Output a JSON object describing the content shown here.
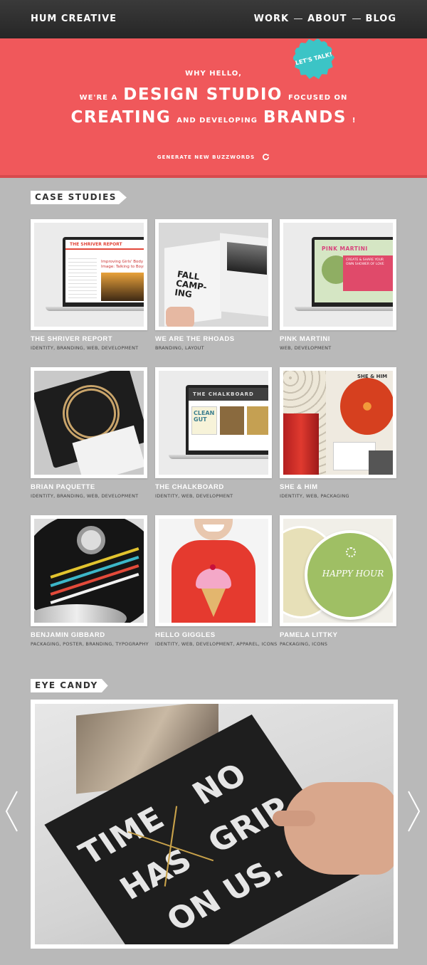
{
  "header": {
    "brand": "HUM CREATIVE",
    "nav": [
      "WORK",
      "ABOUT",
      "BLOG"
    ]
  },
  "hero": {
    "line1": "WHY HELLO,",
    "line2_pre": "WE'RE A",
    "line2_big": "DESIGN STUDIO",
    "line2_post": "FOCUSED ON",
    "line3_big1": "CREATING",
    "line3_mid": "AND DEVELOPING",
    "line3_big2": "BRANDS",
    "line3_end": "!",
    "generate_label": "GENERATE NEW BUZZWORDS",
    "badge": "LET'S TALK!"
  },
  "case_studies": {
    "label": "CASE STUDIES",
    "items": [
      {
        "title": "THE SHRIVER REPORT",
        "tags": "IDENTITY, BRANDING, WEB, DEVELOPMENT"
      },
      {
        "title": "WE ARE THE RHOADS",
        "tags": "BRANDING, LAYOUT"
      },
      {
        "title": "PINK MARTINI",
        "tags": "WEB, DEVELOPMENT"
      },
      {
        "title": "BRIAN PAQUETTE",
        "tags": "IDENTITY, BRANDING, WEB, DEVELOPMENT"
      },
      {
        "title": "THE CHALKBOARD",
        "tags": "IDENTITY, WEB, DEVELOPMENT"
      },
      {
        "title": "SHE & HIM",
        "tags": "IDENTITY, WEB, PACKAGING"
      },
      {
        "title": "BENJAMIN GIBBARD",
        "tags": "PACKAGING, POSTER, BRANDING, TYPOGRAPHY"
      },
      {
        "title": "HELLO GIGGLES",
        "tags": "IDENTITY, WEB, DEVELOPMENT, APPAREL, ICONS"
      },
      {
        "title": "PAMELA LITTKY",
        "tags": "PACKAGING, ICONS"
      }
    ],
    "thumb_text": {
      "shriver_logo": "THE SHRIVER REPORT",
      "shriver_headline": "Improving Girls' Body Image: Talking to Boys",
      "rhoads_left": "FALL CAMP-ING",
      "pink_title": "PINK MARTINI",
      "pink_body": "CREATE & SHARE YOUR OWN SHOWER OF LOVE",
      "chalk_title": "THE CHALKBOARD",
      "chalk_clean": "CLEAN GUT",
      "she_him": "SHE & HIM",
      "happy_hour": "HAPPY HOUR"
    }
  },
  "eye_candy": {
    "label": "EYE CANDY",
    "poster_words": [
      "TIME",
      "HAS",
      "NO",
      "GRIP",
      "ON US."
    ]
  }
}
